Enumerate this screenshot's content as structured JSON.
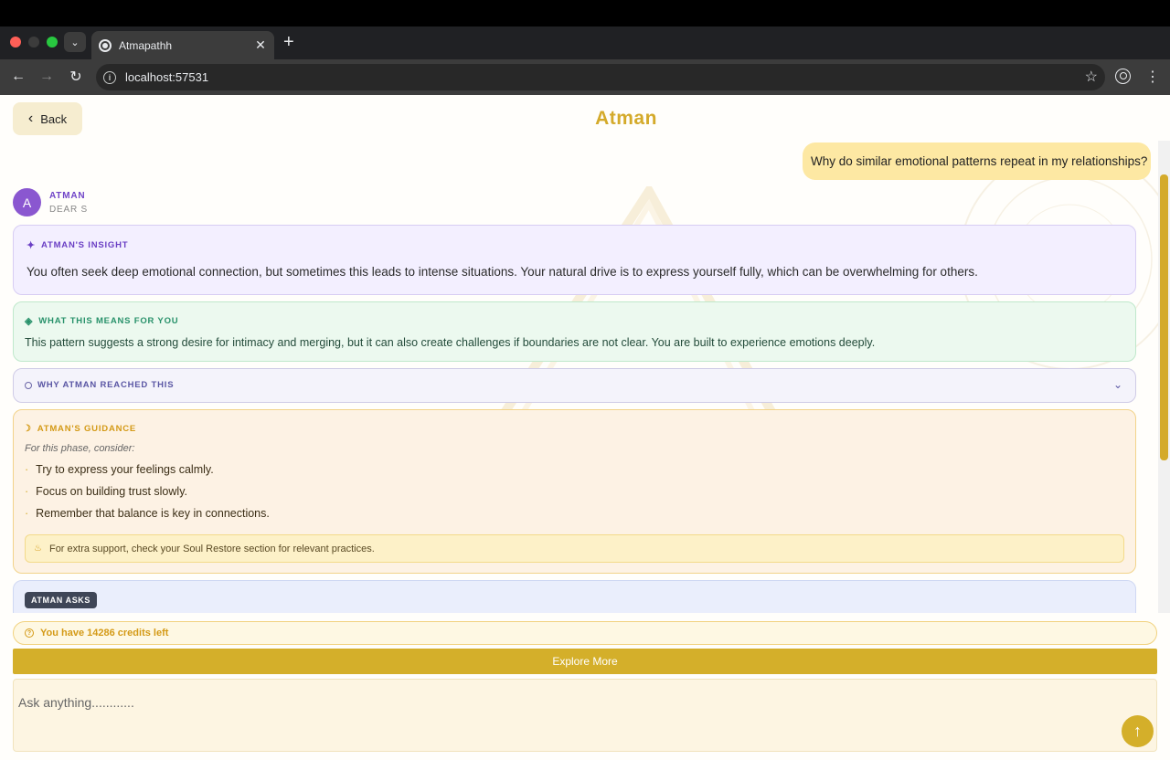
{
  "browser": {
    "tab_title": "Atmapathh",
    "url": "localhost:57531"
  },
  "header": {
    "back_label": "Back",
    "title": "Atman"
  },
  "conversation": {
    "user_message": "Why do similar emotional patterns repeat in my relationships?",
    "assistant": {
      "avatar_letter": "A",
      "name": "ATMAN",
      "subtitle": "DEAR S"
    }
  },
  "insight": {
    "heading": "ATMAN'S INSIGHT",
    "text": "You often seek deep emotional connection, but sometimes this leads to intense situations. Your natural drive is to express yourself fully, which can be overwhelming for others."
  },
  "means": {
    "heading": "WHAT THIS MEANS FOR YOU",
    "text": "This pattern suggests a strong desire for intimacy and merging, but it can also create challenges if boundaries are not clear. You are built to experience emotions deeply."
  },
  "why": {
    "heading": "WHY ATMAN REACHED THIS"
  },
  "guidance": {
    "heading": "ATMAN'S GUIDANCE",
    "intro": "For this phase, consider:",
    "items": [
      "Try to express your feelings calmly.",
      "Focus on building trust slowly.",
      "Remember that balance is key in connections."
    ],
    "tip": "For extra support, check your Soul Restore section for relevant practices."
  },
  "asks": {
    "badge": "ATMAN ASKS"
  },
  "footer": {
    "credits": "You have 14286 credits left",
    "explore_label": "Explore More",
    "ask_placeholder": "Ask anything............"
  },
  "colors": {
    "accent_gold": "#d4af2a",
    "avatar_purple": "#8a57d0",
    "insight_purple": "#6a3fc4",
    "means_green": "#27916a"
  },
  "icons": [
    "chevron-down-icon",
    "chevron-left-icon",
    "close-icon",
    "plus-icon",
    "arrow-left-icon",
    "arrow-right-icon",
    "reload-icon",
    "info-icon",
    "star-icon",
    "profile-icon",
    "kebab-icon",
    "sparkle-icon",
    "diamond-icon",
    "circle-icon",
    "moon-icon",
    "lotus-icon",
    "help-circle-icon",
    "arrow-up-icon"
  ]
}
